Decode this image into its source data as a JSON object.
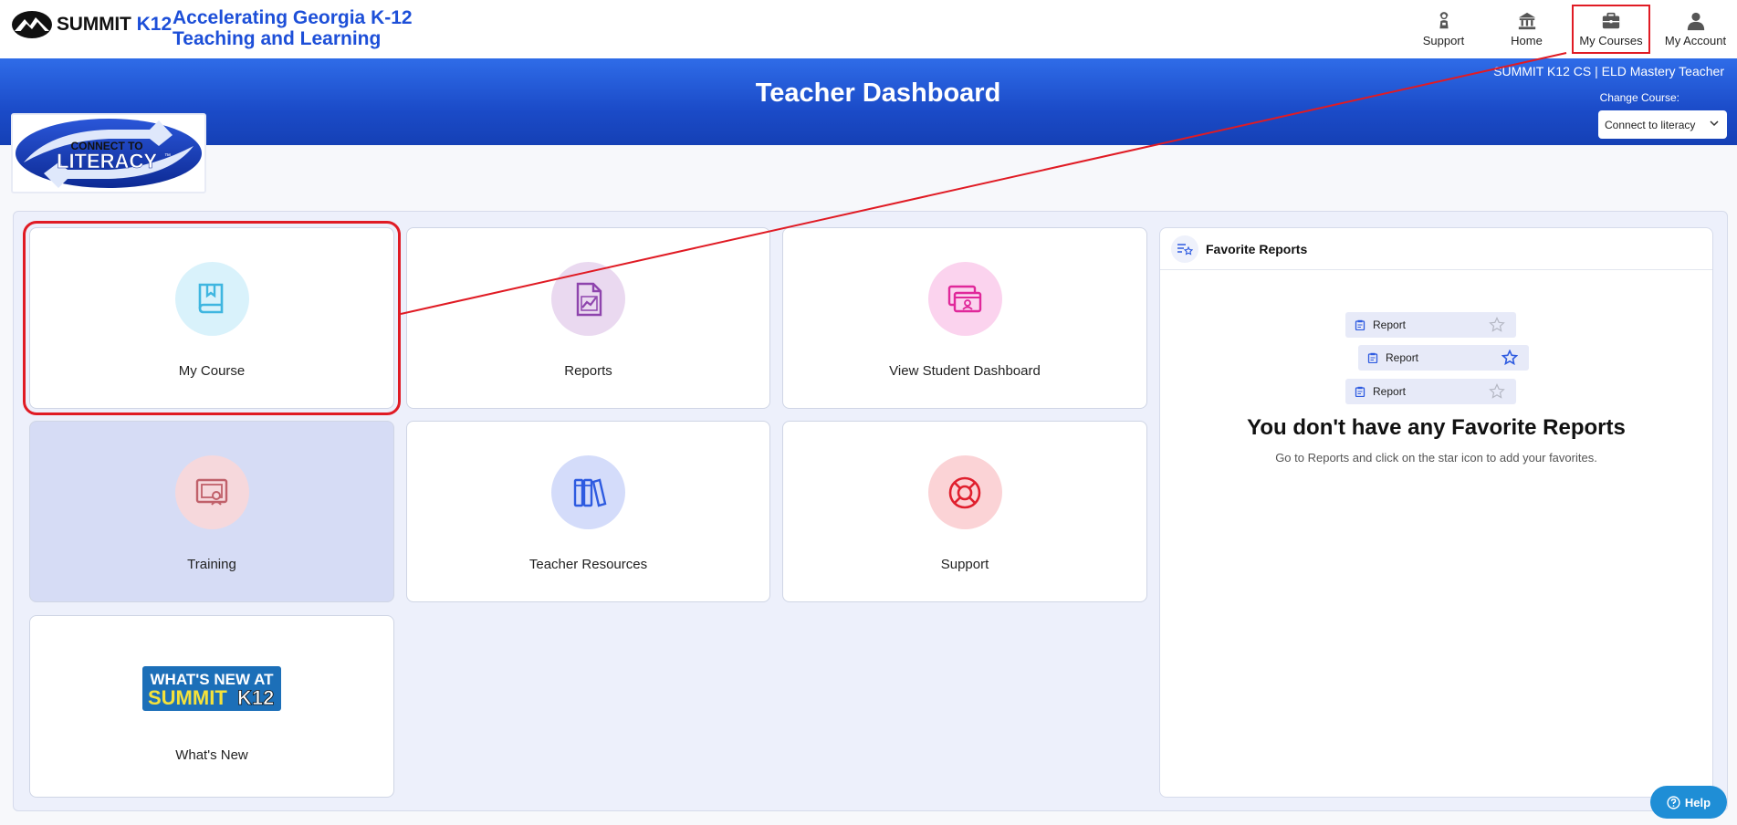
{
  "header": {
    "brand_summit": "SUMMIT",
    "brand_k12": "K12",
    "tagline_line1": "Accelerating Georgia K-12",
    "tagline_line2": "Teaching and Learning",
    "nav": [
      {
        "label": "Support",
        "icon": "support-icon"
      },
      {
        "label": "Home",
        "icon": "home-icon"
      },
      {
        "label": "My Courses",
        "icon": "briefcase-icon"
      },
      {
        "label": "My Account",
        "icon": "user-icon"
      }
    ]
  },
  "band": {
    "title": "Teacher Dashboard",
    "course_info": "SUMMIT K12 CS | ELD Mastery Teacher",
    "change_course_label": "Change Course:",
    "selected_course": "Connect to literacy"
  },
  "logo": {
    "line1": "CONNECT TO",
    "line2": "LITERACY",
    "tm": "™"
  },
  "tiles": [
    {
      "label": "My Course",
      "icon": "book-icon",
      "color": "#3fb6e0",
      "bg": "#d9f2fb"
    },
    {
      "label": "Reports",
      "icon": "report-document-icon",
      "color": "#8e44ad",
      "bg": "#ead9f0"
    },
    {
      "label": "View Student Dashboard",
      "icon": "student-dashboard-icon",
      "color": "#e0289a",
      "bg": "#fbd3ee"
    },
    {
      "label": "Training",
      "icon": "training-presentation-icon",
      "color": "#c0606a",
      "bg": "#f6d8dc"
    },
    {
      "label": "Teacher Resources",
      "icon": "books-icon",
      "color": "#2e5be0",
      "bg": "#d4dcfa"
    },
    {
      "label": "Support",
      "icon": "lifebuoy-icon",
      "color": "#e0202e",
      "bg": "#fbd3d6"
    },
    {
      "label": "What's New",
      "icon": "whats-new-banner"
    }
  ],
  "whats_new_banner": {
    "line1": "WHAT'S NEW AT",
    "line2a": "SUMMIT",
    "line2b": "K12"
  },
  "favorites": {
    "title": "Favorite Reports",
    "sample_rows": [
      "Report",
      "Report",
      "Report"
    ],
    "empty_title": "You don't have any Favorite Reports",
    "empty_sub": "Go to Reports and click on the star icon to add your favorites."
  },
  "help": {
    "label": "Help"
  }
}
